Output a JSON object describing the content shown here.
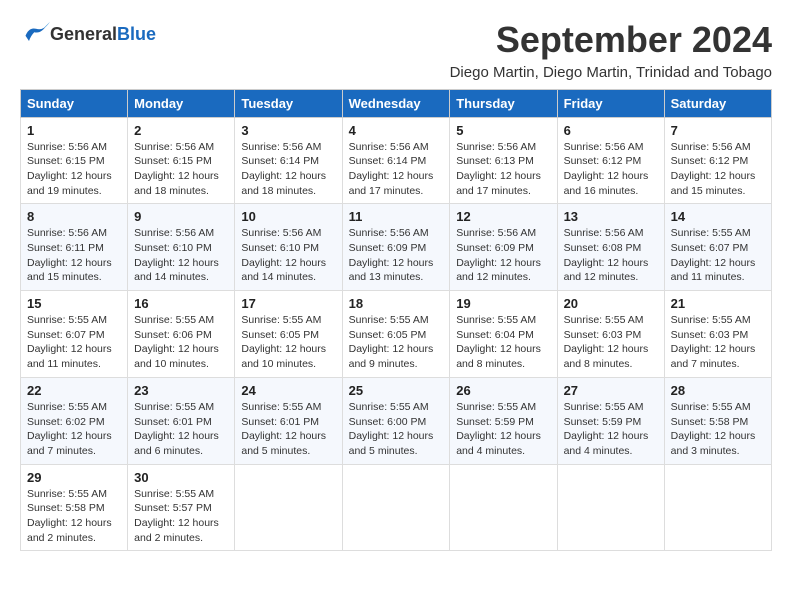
{
  "logo": {
    "text_general": "General",
    "text_blue": "Blue"
  },
  "title": {
    "month_year": "September 2024",
    "location": "Diego Martin, Diego Martin, Trinidad and Tobago"
  },
  "calendar": {
    "headers": [
      "Sunday",
      "Monday",
      "Tuesday",
      "Wednesday",
      "Thursday",
      "Friday",
      "Saturday"
    ],
    "weeks": [
      [
        {
          "day": "1",
          "sunrise": "5:56 AM",
          "sunset": "6:15 PM",
          "daylight": "12 hours and 19 minutes."
        },
        {
          "day": "2",
          "sunrise": "5:56 AM",
          "sunset": "6:15 PM",
          "daylight": "12 hours and 18 minutes."
        },
        {
          "day": "3",
          "sunrise": "5:56 AM",
          "sunset": "6:14 PM",
          "daylight": "12 hours and 18 minutes."
        },
        {
          "day": "4",
          "sunrise": "5:56 AM",
          "sunset": "6:14 PM",
          "daylight": "12 hours and 17 minutes."
        },
        {
          "day": "5",
          "sunrise": "5:56 AM",
          "sunset": "6:13 PM",
          "daylight": "12 hours and 17 minutes."
        },
        {
          "day": "6",
          "sunrise": "5:56 AM",
          "sunset": "6:12 PM",
          "daylight": "12 hours and 16 minutes."
        },
        {
          "day": "7",
          "sunrise": "5:56 AM",
          "sunset": "6:12 PM",
          "daylight": "12 hours and 15 minutes."
        }
      ],
      [
        {
          "day": "8",
          "sunrise": "5:56 AM",
          "sunset": "6:11 PM",
          "daylight": "12 hours and 15 minutes."
        },
        {
          "day": "9",
          "sunrise": "5:56 AM",
          "sunset": "6:10 PM",
          "daylight": "12 hours and 14 minutes."
        },
        {
          "day": "10",
          "sunrise": "5:56 AM",
          "sunset": "6:10 PM",
          "daylight": "12 hours and 14 minutes."
        },
        {
          "day": "11",
          "sunrise": "5:56 AM",
          "sunset": "6:09 PM",
          "daylight": "12 hours and 13 minutes."
        },
        {
          "day": "12",
          "sunrise": "5:56 AM",
          "sunset": "6:09 PM",
          "daylight": "12 hours and 12 minutes."
        },
        {
          "day": "13",
          "sunrise": "5:56 AM",
          "sunset": "6:08 PM",
          "daylight": "12 hours and 12 minutes."
        },
        {
          "day": "14",
          "sunrise": "5:55 AM",
          "sunset": "6:07 PM",
          "daylight": "12 hours and 11 minutes."
        }
      ],
      [
        {
          "day": "15",
          "sunrise": "5:55 AM",
          "sunset": "6:07 PM",
          "daylight": "12 hours and 11 minutes."
        },
        {
          "day": "16",
          "sunrise": "5:55 AM",
          "sunset": "6:06 PM",
          "daylight": "12 hours and 10 minutes."
        },
        {
          "day": "17",
          "sunrise": "5:55 AM",
          "sunset": "6:05 PM",
          "daylight": "12 hours and 10 minutes."
        },
        {
          "day": "18",
          "sunrise": "5:55 AM",
          "sunset": "6:05 PM",
          "daylight": "12 hours and 9 minutes."
        },
        {
          "day": "19",
          "sunrise": "5:55 AM",
          "sunset": "6:04 PM",
          "daylight": "12 hours and 8 minutes."
        },
        {
          "day": "20",
          "sunrise": "5:55 AM",
          "sunset": "6:03 PM",
          "daylight": "12 hours and 8 minutes."
        },
        {
          "day": "21",
          "sunrise": "5:55 AM",
          "sunset": "6:03 PM",
          "daylight": "12 hours and 7 minutes."
        }
      ],
      [
        {
          "day": "22",
          "sunrise": "5:55 AM",
          "sunset": "6:02 PM",
          "daylight": "12 hours and 7 minutes."
        },
        {
          "day": "23",
          "sunrise": "5:55 AM",
          "sunset": "6:01 PM",
          "daylight": "12 hours and 6 minutes."
        },
        {
          "day": "24",
          "sunrise": "5:55 AM",
          "sunset": "6:01 PM",
          "daylight": "12 hours and 5 minutes."
        },
        {
          "day": "25",
          "sunrise": "5:55 AM",
          "sunset": "6:00 PM",
          "daylight": "12 hours and 5 minutes."
        },
        {
          "day": "26",
          "sunrise": "5:55 AM",
          "sunset": "5:59 PM",
          "daylight": "12 hours and 4 minutes."
        },
        {
          "day": "27",
          "sunrise": "5:55 AM",
          "sunset": "5:59 PM",
          "daylight": "12 hours and 4 minutes."
        },
        {
          "day": "28",
          "sunrise": "5:55 AM",
          "sunset": "5:58 PM",
          "daylight": "12 hours and 3 minutes."
        }
      ],
      [
        {
          "day": "29",
          "sunrise": "5:55 AM",
          "sunset": "5:58 PM",
          "daylight": "12 hours and 2 minutes."
        },
        {
          "day": "30",
          "sunrise": "5:55 AM",
          "sunset": "5:57 PM",
          "daylight": "12 hours and 2 minutes."
        },
        null,
        null,
        null,
        null,
        null
      ]
    ]
  }
}
